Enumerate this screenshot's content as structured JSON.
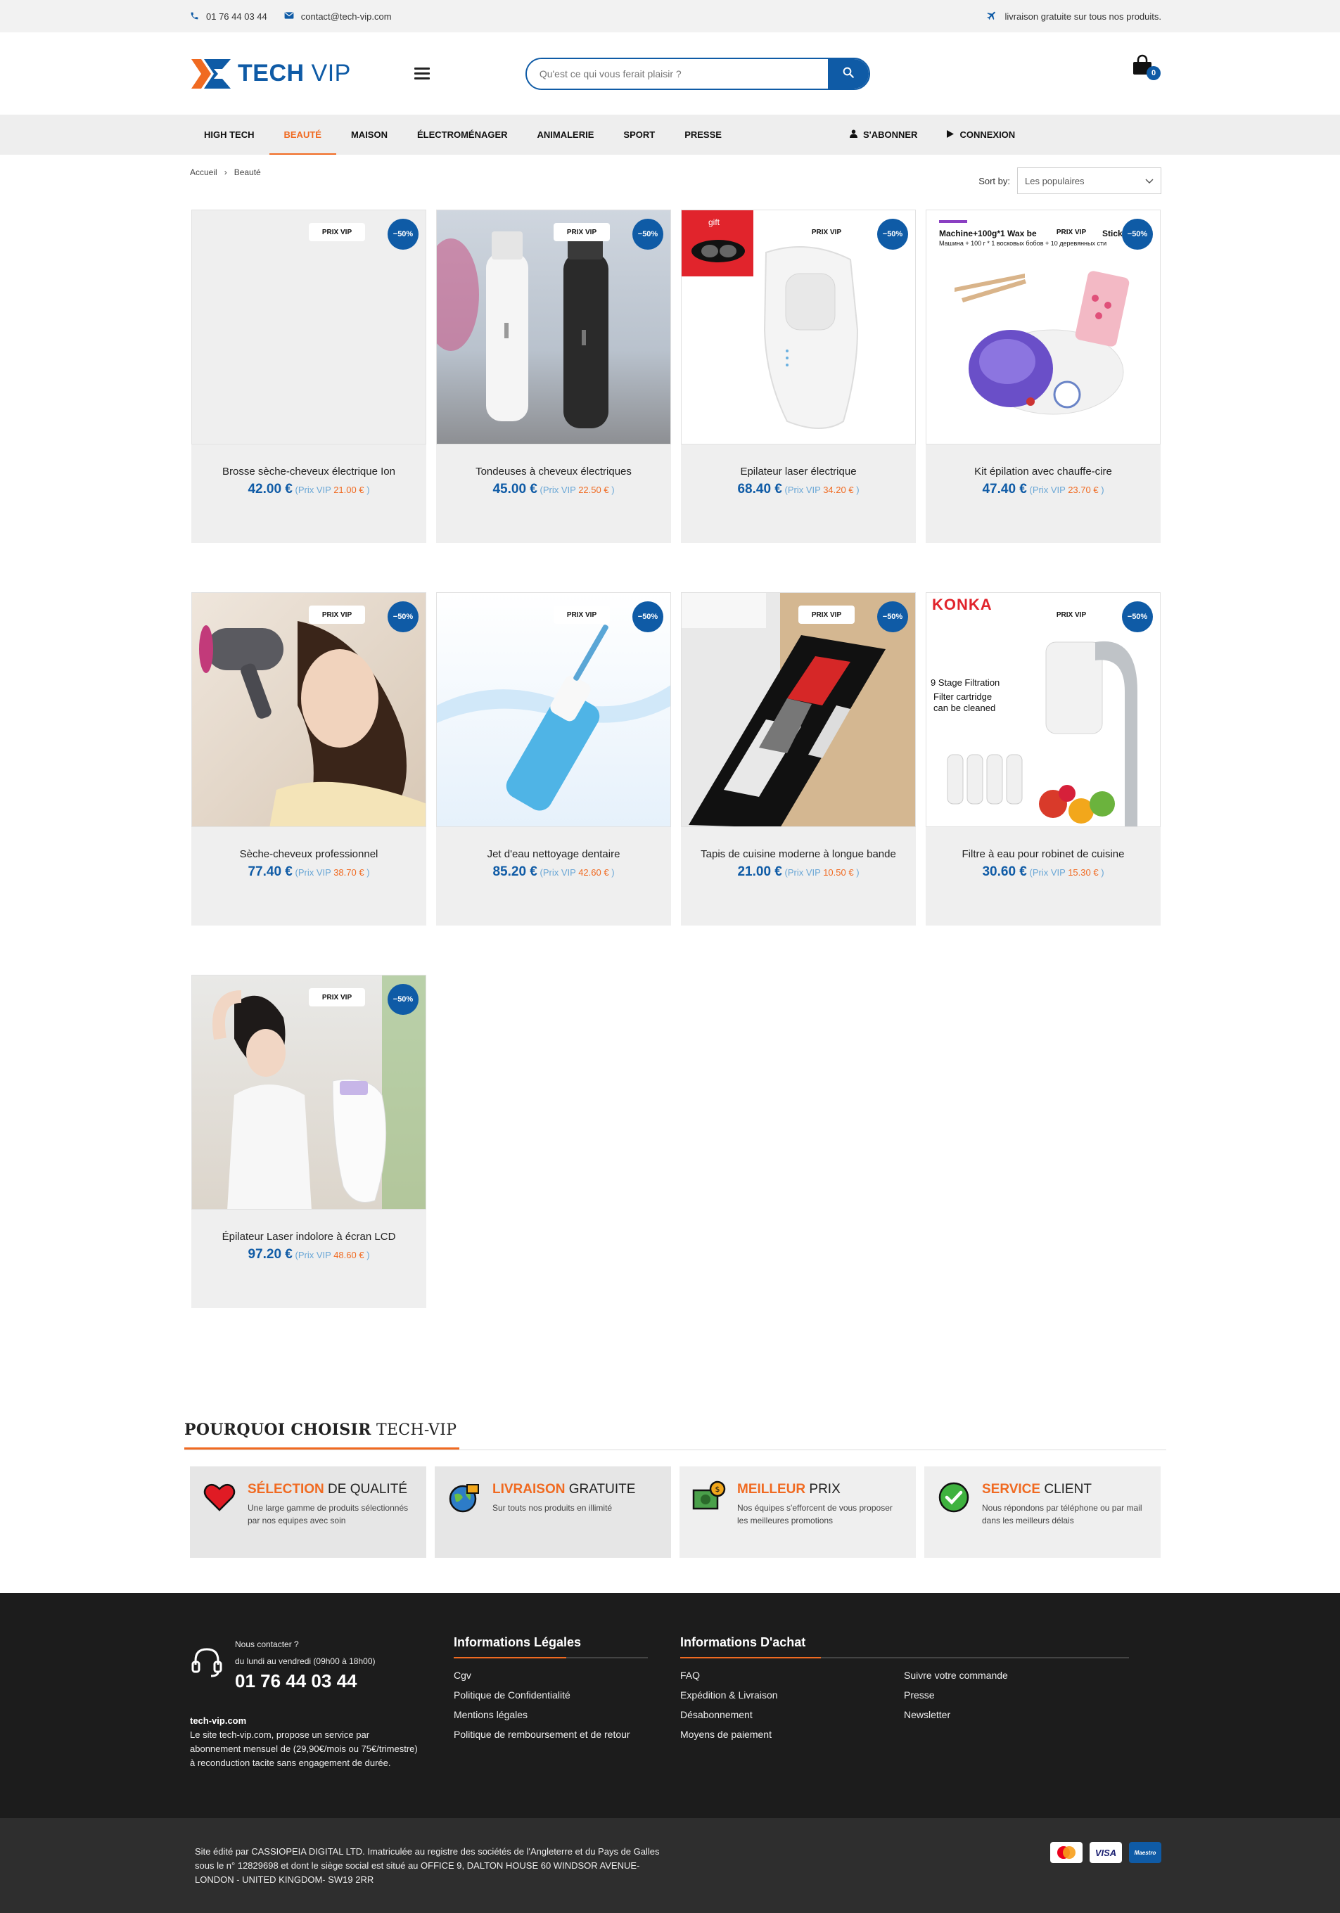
{
  "topbar": {
    "phone": "01 76 44 03 44",
    "email": "contact@tech-vip.com",
    "shipping": "livraison gratuite sur tous nos produits."
  },
  "header": {
    "logo_main": "TECH",
    "logo_vip": "VIP",
    "search_placeholder": "Qu'est ce qui vous ferait plaisir ?",
    "cart_count": "0"
  },
  "nav": {
    "items": [
      "HIGH TECH",
      "BEAUTÉ",
      "MAISON",
      "ÉLECTROMÉNAGER",
      "ANIMALERIE",
      "SPORT",
      "PRESSE"
    ],
    "subscribe": "S'ABONNER",
    "login": "CONNEXION"
  },
  "breadcrumb": {
    "home": "Accueil",
    "sep": "›",
    "current": "Beauté"
  },
  "sort": {
    "label": "Sort by:",
    "value": "Les populaires"
  },
  "badges": {
    "vip": "PRIX VIP",
    "off": "−50%"
  },
  "price_vip_label": "(Prix VIP",
  "price_close": ")",
  "products": [
    {
      "name": "Brosse sèche-cheveux électrique Ion",
      "price": "42.00 €",
      "vip": "21.00 €"
    },
    {
      "name": "Tondeuses à cheveux électriques",
      "price": "45.00 €",
      "vip": "22.50 €"
    },
    {
      "name": "Epilateur laser électrique",
      "price": "68.40 €",
      "vip": "34.20 €"
    },
    {
      "name": "Kit épilation avec chauffe-cire",
      "price": "47.40 €",
      "vip": "23.70 €"
    },
    {
      "name": "Sèche-cheveux professionnel",
      "price": "77.40 €",
      "vip": "38.70 €"
    },
    {
      "name": "Jet d'eau nettoyage dentaire",
      "price": "85.20 €",
      "vip": "42.60 €"
    },
    {
      "name": "Tapis de cuisine moderne à longue bande",
      "price": "21.00 €",
      "vip": "10.50 €"
    },
    {
      "name": "Filtre à eau pour robinet de cuisine",
      "price": "30.60 €",
      "vip": "15.30 €"
    },
    {
      "name": "Épilateur Laser indolore à écran LCD",
      "price": "97.20 €",
      "vip": "48.60 €"
    }
  ],
  "image_texts": {
    "gift": "gift",
    "wax": "Machine+100g*1 Wax be",
    "wax_sub": "Машина + 100 г * 1 восковых бобов + 10 деревянных сти",
    "wax_stick": "Stick",
    "konka": "KONKA",
    "filter1": "9 Stage Filtration",
    "filter2": "Filter cartridge",
    "filter3": "can be cleaned"
  },
  "why": {
    "title_bold": "POURQUOI CHOISIR",
    "title_rest": "TECH-VIP",
    "items": [
      {
        "hl": "SÉLECTION",
        "rest": "DE QUALITÉ",
        "text": "Une large gamme de produits sélectionnés par nos equipes avec soin"
      },
      {
        "hl": "LIVRAISON",
        "rest": "GRATUITE",
        "text": "Sur touts nos produits en illimité"
      },
      {
        "hl": "MEILLEUR",
        "rest": "PRIX",
        "text": "Nos équipes s'efforcent de vous proposer les meilleures promotions"
      },
      {
        "hl": "SERVICE",
        "rest": "CLIENT",
        "text": "Nous répondons par téléphone ou par mail dans les meilleurs délais"
      }
    ]
  },
  "footer": {
    "contact_label": "Nous contacter ?",
    "hours": "du lundi au vendredi (09h00 à 18h00)",
    "phone": "01 76 44 03 44",
    "site": "tech-vip.com",
    "about": "Le site tech-vip.com, propose un service par abonnement mensuel de (29,90€/mois ou 75€/trimestre) à reconduction tacite sans engagement de durée.",
    "legal_title": "Informations Légales",
    "legal_links": [
      "Cgv",
      "Politique de Confidentialité",
      "Mentions légales",
      "Politique de remboursement et de retour"
    ],
    "buy_title": "Informations D'achat",
    "buy_links_1": [
      "FAQ",
      "Expédition & Livraison",
      "Désabonnement",
      "Moyens de paiement"
    ],
    "buy_links_2": [
      "Suivre votre commande",
      "Presse",
      "Newsletter"
    ],
    "legal_text": "Site édité par CASSIOPEIA DIGITAL LTD. Imatriculée au registre des sociétés de l'Angleterre et du Pays de Galles sous le n° 12829698 et dont le siège social est situé au OFFICE 9, DALTON HOUSE 60 WINDSOR AVENUE- LONDON - UNITED KINGDOM- SW19 2RR",
    "card_visa": "VISA",
    "card_maestro": "Maestro"
  },
  "colors": {
    "brand": "#0f5ba6",
    "accent": "#f06a21"
  }
}
